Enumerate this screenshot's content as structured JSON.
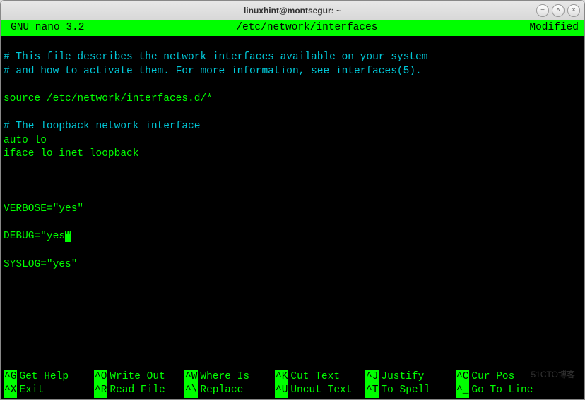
{
  "window": {
    "title": "linuxhint@montsegur: ~",
    "controls": {
      "minimize": "−",
      "maximize": "˄",
      "close": "×"
    }
  },
  "nano": {
    "header": {
      "version": "GNU nano 3.2",
      "filepath": "/etc/network/interfaces",
      "status": "Modified"
    },
    "content": {
      "line1": "# This file describes the network interfaces available on your system",
      "line2": "# and how to activate them. For more information, see interfaces(5).",
      "line3": "",
      "line4": "source /etc/network/interfaces.d/*",
      "line5": "",
      "line6": "# The loopback network interface",
      "line7": "auto lo",
      "line8": "iface lo inet loopback",
      "line9": "",
      "line10": "",
      "line11": "",
      "line12": "VERBOSE=\"yes\"",
      "line13": "",
      "line14a": "DEBUG=\"yes",
      "line14cursor": "\"",
      "line15": "",
      "line16": "SYSLOG=\"yes\"",
      "line17": "",
      "line18": "",
      "line19": ""
    },
    "shortcuts": {
      "row1": [
        {
          "key": "^G",
          "label": "Get Help"
        },
        {
          "key": "^O",
          "label": "Write Out"
        },
        {
          "key": "^W",
          "label": "Where Is"
        },
        {
          "key": "^K",
          "label": "Cut Text"
        },
        {
          "key": "^J",
          "label": "Justify"
        },
        {
          "key": "^C",
          "label": "Cur Pos"
        }
      ],
      "row2": [
        {
          "key": "^X",
          "label": "Exit"
        },
        {
          "key": "^R",
          "label": "Read File"
        },
        {
          "key": "^\\",
          "label": "Replace"
        },
        {
          "key": "^U",
          "label": "Uncut Text"
        },
        {
          "key": "^T",
          "label": "To Spell"
        },
        {
          "key": "^_",
          "label": "Go To Line"
        }
      ]
    }
  },
  "watermark": "51CTO博客"
}
